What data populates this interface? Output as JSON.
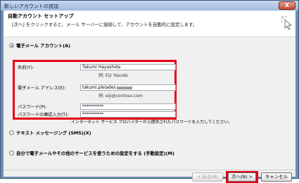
{
  "window": {
    "title": "新しいアカウントの追加",
    "close_label": "X"
  },
  "header": {
    "title": "自動アカウント セットアップ",
    "description": "[次へ] をクリックすると、メール サーバーに接続して、アカウントを自動的に設定します。"
  },
  "options": {
    "email_account": {
      "label": "電子メール アカウント(A)",
      "selected": true
    },
    "text_messaging": {
      "label": "テキスト メッセージング (SMS)(X)",
      "selected": false
    },
    "manual": {
      "label": "自分で電子メールやその他のサービスを使うための設定をする (手動設定)(M)",
      "selected": false
    }
  },
  "form": {
    "name": {
      "label": "名前(Y):",
      "value": "Takumi Hayashida",
      "example": "例: Eiji Yasuda"
    },
    "email": {
      "label": "電子メール アドレス(E):",
      "value": "takumi.pleiades",
      "example": "例: eiji@contoso.com"
    },
    "password": {
      "label": "パスワード(P):",
      "value": "**********"
    },
    "password_confirm": {
      "label": "パスワードの確認入力(T):",
      "value": "**********"
    },
    "note": "インターネット サービス プロバイダーから提供されたパスワードを入力してください。"
  },
  "buttons": {
    "back": "< 戻る(B)",
    "next": "次へ(N) >",
    "cancel": "キャンセル"
  },
  "colors": {
    "highlight": "#e60012"
  }
}
